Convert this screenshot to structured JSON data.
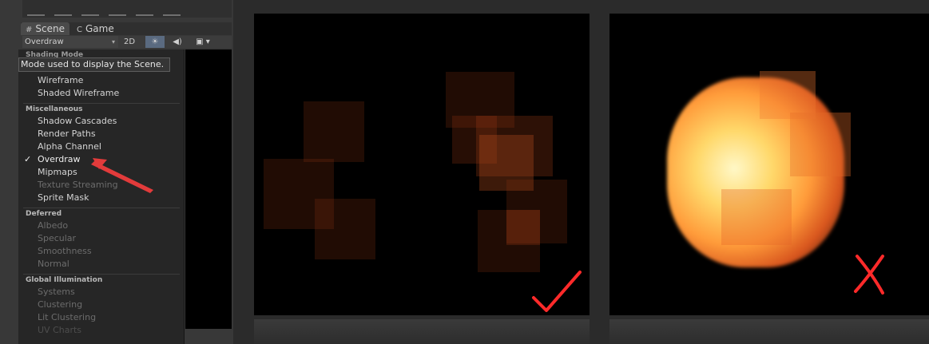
{
  "tabs": {
    "scene": "Scene",
    "game": "Game",
    "scene_glyph": "#",
    "game_glyph": "C"
  },
  "scene_toolbar": {
    "draw_mode": "Overdraw",
    "mode_2d": "2D",
    "lighting_glyph": "☀",
    "audio_glyph": "◀)",
    "effects_glyph": "▣ ▾"
  },
  "menu": {
    "cut_header": "Shading Mode",
    "tooltip": "Mode used to display the Scene.",
    "items_top": [
      "Wireframe",
      "Shaded Wireframe"
    ],
    "misc_header": "Miscellaneous",
    "misc_items": [
      "Shadow Cascades",
      "Render Paths",
      "Alpha Channel",
      "Overdraw",
      "Mipmaps",
      "Texture Streaming",
      "Sprite Mask"
    ],
    "checked_item": "Overdraw",
    "check_glyph": "✓",
    "deferred_header": "Deferred",
    "deferred_items": [
      "Albedo",
      "Specular",
      "Smoothness",
      "Normal"
    ],
    "gi_header": "Global Illumination",
    "gi_items": [
      "Systems",
      "Clustering",
      "Lit Clustering",
      "UV Charts"
    ]
  },
  "annotations": {
    "arrow_color": "#e23b3b",
    "good_mark": "check",
    "bad_mark": "cross"
  }
}
